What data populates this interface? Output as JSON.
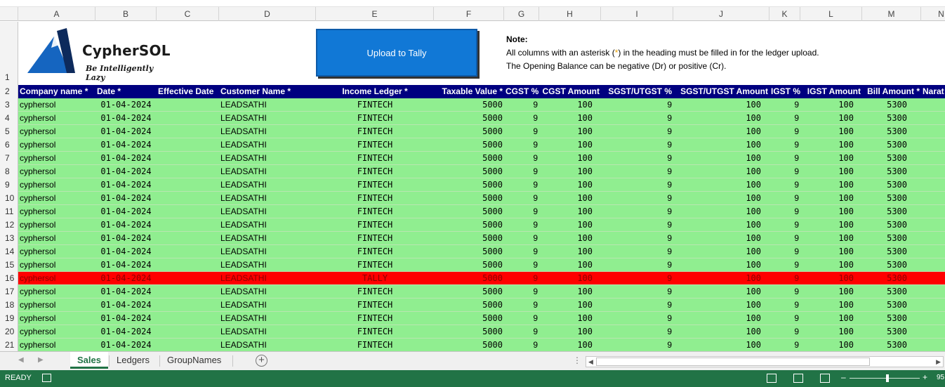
{
  "columns": [
    "A",
    "B",
    "C",
    "D",
    "E",
    "F",
    "G",
    "H",
    "I",
    "J",
    "K",
    "L",
    "M",
    "N"
  ],
  "banner": {
    "brand": "CypherSOL",
    "tagline": "Be Intelligently Lazy",
    "upload_label": "Upload to Tally",
    "note_title": "Note:",
    "note_line1_before": "All columns with an asterisk (",
    "note_line1_star": "*",
    "note_line1_after": ") in the heading must be filled in for the ledger upload.",
    "note_line2": "The Opening Balance can be negative (Dr) or positive (Cr)."
  },
  "row_numbers": [
    "1",
    "2",
    "3",
    "4",
    "5",
    "6",
    "7",
    "8",
    "9",
    "10",
    "11",
    "12",
    "13",
    "14",
    "15",
    "16",
    "17",
    "18",
    "19",
    "20",
    "21"
  ],
  "headers": [
    "Company name *",
    "Date *",
    "Effective Date",
    "Customer Name *",
    "Income Ledger *",
    "Taxable Value *",
    "CGST %",
    "CGST Amount",
    "SGST/UTGST  %",
    "SGST/UTGST Amount",
    "IGST %",
    "IGST Amount",
    "Bill Amount *",
    "Narat"
  ],
  "rows": [
    {
      "status": "ok",
      "cells": [
        "cyphersol",
        "01-04-2024",
        "",
        "LEADSATHI",
        "FINTECH",
        "5000",
        "9",
        "100",
        "9",
        "100",
        "9",
        "100",
        "5300"
      ]
    },
    {
      "status": "ok",
      "cells": [
        "cyphersol",
        "01-04-2024",
        "",
        "LEADSATHI",
        "FINTECH",
        "5000",
        "9",
        "100",
        "9",
        "100",
        "9",
        "100",
        "5300"
      ]
    },
    {
      "status": "ok",
      "cells": [
        "cyphersol",
        "01-04-2024",
        "",
        "LEADSATHI",
        "FINTECH",
        "5000",
        "9",
        "100",
        "9",
        "100",
        "9",
        "100",
        "5300"
      ]
    },
    {
      "status": "ok",
      "cells": [
        "cyphersol",
        "01-04-2024",
        "",
        "LEADSATHI",
        "FINTECH",
        "5000",
        "9",
        "100",
        "9",
        "100",
        "9",
        "100",
        "5300"
      ]
    },
    {
      "status": "ok",
      "cells": [
        "cyphersol",
        "01-04-2024",
        "",
        "LEADSATHI",
        "FINTECH",
        "5000",
        "9",
        "100",
        "9",
        "100",
        "9",
        "100",
        "5300"
      ]
    },
    {
      "status": "ok",
      "cells": [
        "cyphersol",
        "01-04-2024",
        "",
        "LEADSATHI",
        "FINTECH",
        "5000",
        "9",
        "100",
        "9",
        "100",
        "9",
        "100",
        "5300"
      ]
    },
    {
      "status": "ok",
      "cells": [
        "cyphersol",
        "01-04-2024",
        "",
        "LEADSATHI",
        "FINTECH",
        "5000",
        "9",
        "100",
        "9",
        "100",
        "9",
        "100",
        "5300"
      ]
    },
    {
      "status": "ok",
      "cells": [
        "cyphersol",
        "01-04-2024",
        "",
        "LEADSATHI",
        "FINTECH",
        "5000",
        "9",
        "100",
        "9",
        "100",
        "9",
        "100",
        "5300"
      ]
    },
    {
      "status": "ok",
      "cells": [
        "cyphersol",
        "01-04-2024",
        "",
        "LEADSATHI",
        "FINTECH",
        "5000",
        "9",
        "100",
        "9",
        "100",
        "9",
        "100",
        "5300"
      ]
    },
    {
      "status": "ok",
      "cells": [
        "cyphersol",
        "01-04-2024",
        "",
        "LEADSATHI",
        "FINTECH",
        "5000",
        "9",
        "100",
        "9",
        "100",
        "9",
        "100",
        "5300"
      ]
    },
    {
      "status": "ok",
      "cells": [
        "cyphersol",
        "01-04-2024",
        "",
        "LEADSATHI",
        "FINTECH",
        "5000",
        "9",
        "100",
        "9",
        "100",
        "9",
        "100",
        "5300"
      ]
    },
    {
      "status": "ok",
      "cells": [
        "cyphersol",
        "01-04-2024",
        "",
        "LEADSATHI",
        "FINTECH",
        "5000",
        "9",
        "100",
        "9",
        "100",
        "9",
        "100",
        "5300"
      ]
    },
    {
      "status": "ok",
      "cells": [
        "cyphersol",
        "01-04-2024",
        "",
        "LEADSATHI",
        "FINTECH",
        "5000",
        "9",
        "100",
        "9",
        "100",
        "9",
        "100",
        "5300"
      ]
    },
    {
      "status": "error",
      "cells": [
        "cyphersol",
        "01-04-2024",
        "",
        "LEADSATHI",
        "TALLY",
        "5000",
        "9",
        "100",
        "9",
        "100",
        "9",
        "100",
        "5300"
      ]
    },
    {
      "status": "ok",
      "cells": [
        "cyphersol",
        "01-04-2024",
        "",
        "LEADSATHI",
        "FINTECH",
        "5000",
        "9",
        "100",
        "9",
        "100",
        "9",
        "100",
        "5300"
      ]
    },
    {
      "status": "ok",
      "cells": [
        "cyphersol",
        "01-04-2024",
        "",
        "LEADSATHI",
        "FINTECH",
        "5000",
        "9",
        "100",
        "9",
        "100",
        "9",
        "100",
        "5300"
      ]
    },
    {
      "status": "ok",
      "cells": [
        "cyphersol",
        "01-04-2024",
        "",
        "LEADSATHI",
        "FINTECH",
        "5000",
        "9",
        "100",
        "9",
        "100",
        "9",
        "100",
        "5300"
      ]
    },
    {
      "status": "ok",
      "cells": [
        "cyphersol",
        "01-04-2024",
        "",
        "LEADSATHI",
        "FINTECH",
        "5000",
        "9",
        "100",
        "9",
        "100",
        "9",
        "100",
        "5300"
      ]
    },
    {
      "status": "ok",
      "cells": [
        "cyphersol",
        "01-04-2024",
        "",
        "LEADSATHI",
        "FINTECH",
        "5000",
        "9",
        "100",
        "9",
        "100",
        "9",
        "100",
        "5300"
      ]
    }
  ],
  "sheet_tabs": [
    "Sales",
    "Ledgers",
    "GroupNames"
  ],
  "active_tab": "Sales",
  "status": {
    "ready": "READY",
    "zoom": "95"
  },
  "colors": {
    "header_bg": "#000080",
    "ok_row": "#90ee90",
    "error_row": "#ff0000",
    "status_bar": "#217346",
    "button": "#1178d6"
  }
}
